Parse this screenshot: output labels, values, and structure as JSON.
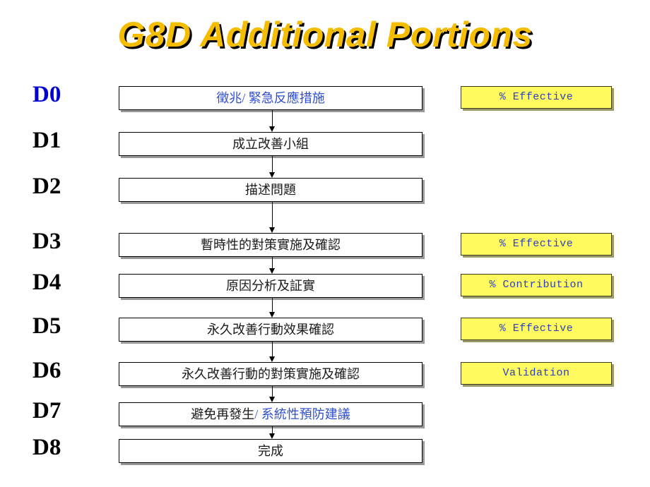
{
  "title": "G8D Additional Portions",
  "steps": [
    {
      "label": "D0",
      "label_color": "#0000D4",
      "label_is_blue": true,
      "box_text": "徵兆/ 緊急反應措施",
      "box_text_color": "blue",
      "badge": "% Effective"
    },
    {
      "label": "D1",
      "label_color": "#000000",
      "label_is_blue": false,
      "box_text": "成立改善小組",
      "box_text_color": "black",
      "badge": ""
    },
    {
      "label": "D2",
      "label_color": "#000000",
      "label_is_blue": false,
      "box_text": "描述問題",
      "box_text_color": "black",
      "badge": ""
    },
    {
      "label": "D3",
      "label_color": "#000000",
      "label_is_blue": false,
      "box_text": "暫時性的對策實施及確認",
      "box_text_color": "black",
      "badge": "% Effective"
    },
    {
      "label": "D4",
      "label_color": "#000000",
      "label_is_blue": false,
      "box_text": "原因分析及証實",
      "box_text_color": "black",
      "badge": "% Contribution"
    },
    {
      "label": "D5",
      "label_color": "#000000",
      "label_is_blue": false,
      "box_text": "永久改善行動效果確認",
      "box_text_color": "black",
      "badge": "% Effective"
    },
    {
      "label": "D6",
      "label_color": "#000000",
      "label_is_blue": false,
      "box_text": "永久改善行動的對策實施及確認",
      "box_text_color": "black",
      "badge": "Validation"
    },
    {
      "label": "D7",
      "label_color": "#000000",
      "label_is_blue": false,
      "box_text_black_part": "避免再發生",
      "box_text_blue_part": "/ 系統性預防建議",
      "box_text_color": "mixed",
      "badge": ""
    },
    {
      "label": "D8",
      "label_color": "#000000",
      "label_is_blue": false,
      "box_text": "完成",
      "box_text_color": "black",
      "badge": ""
    }
  ],
  "colors": {
    "title_fill": "#F5BD00",
    "title_shadow": "#000000",
    "badge_fill": "#FFFB5E",
    "badge_text": "#2A3FC0",
    "blue_text": "#2F4FD0",
    "label_blue": "#0000D4",
    "box_border": "#000000",
    "box_shadow": "#999999",
    "arrow": "#000000",
    "background": "#FFFFFF"
  }
}
